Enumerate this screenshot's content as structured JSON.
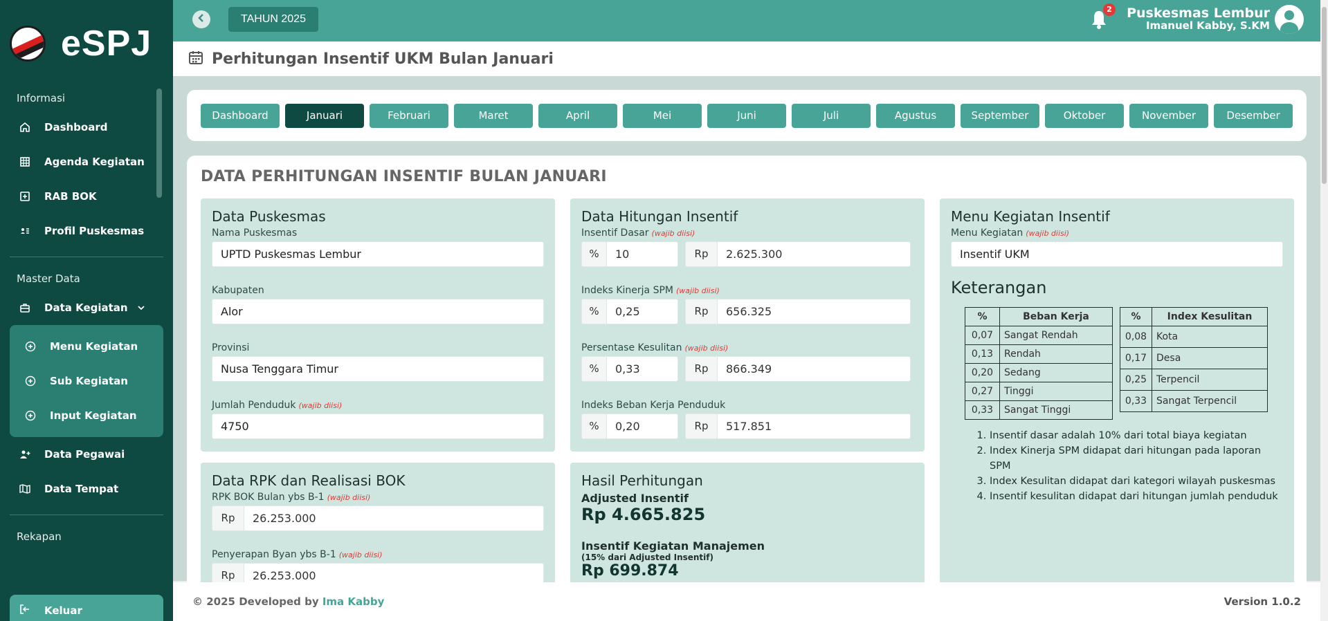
{
  "app": {
    "name": "eSPJ"
  },
  "sidebar": {
    "sections": [
      {
        "label": "Informasi"
      },
      {
        "label": "Master Data"
      },
      {
        "label": "Rekapan"
      }
    ],
    "info_items": [
      {
        "label": "Dashboard",
        "icon": "home-icon"
      },
      {
        "label": "Agenda Kegiatan",
        "icon": "grid-icon"
      },
      {
        "label": "RAB BOK",
        "icon": "plus-square-icon"
      },
      {
        "label": "Profil Puskesmas",
        "icon": "id-card-icon"
      }
    ],
    "master_items": {
      "data_kegiatan": "Data Kegiatan",
      "sub": [
        {
          "label": "Menu Kegiatan"
        },
        {
          "label": "Sub Kegiatan"
        },
        {
          "label": "Input Kegiatan"
        }
      ],
      "data_pegawai": "Data Pegawai",
      "data_tempat": "Data Tempat"
    },
    "logout": "Keluar"
  },
  "topbar": {
    "year": "TAHUN 2025",
    "notif_count": "2",
    "puskesmas": "Puskesmas Lembur",
    "user": "Imanuel Kabby, S.KM"
  },
  "page_title": "Perhitungan Insentif UKM Bulan Januari",
  "months": [
    "Dashboard",
    "Januari",
    "Februari",
    "Maret",
    "April",
    "Mei",
    "Juni",
    "Juli",
    "Agustus",
    "September",
    "Oktober",
    "November",
    "Desember"
  ],
  "active_month": "Januari",
  "main_heading": "DATA PERHITUNGAN INSENTIF BULAN JANUARI",
  "required_tag": "(wajib diisi)",
  "data_puskesmas": {
    "title": "Data Puskesmas",
    "nama_label": "Nama Puskesmas",
    "nama": "UPTD Puskesmas Lembur",
    "kabupaten_label": "Kabupaten",
    "kabupaten": "Alor",
    "provinsi_label": "Provinsi",
    "provinsi": "Nusa Tenggara Timur",
    "penduduk_label": "Jumlah Penduduk",
    "penduduk": "4750"
  },
  "data_hitungan": {
    "title": "Data Hitungan Insentif",
    "rows": [
      {
        "label": "Insentif Dasar",
        "pct": "10",
        "rp": "2.625.300"
      },
      {
        "label": "Indeks Kinerja SPM",
        "pct": "0,25",
        "rp": "656.325"
      },
      {
        "label": "Persentase Kesulitan",
        "pct": "0,33",
        "rp": "866.349"
      },
      {
        "label": "Indeks Beban Kerja Penduduk",
        "pct": "0,20",
        "rp": "517.851"
      }
    ],
    "pct_symbol": "%",
    "rp_symbol": "Rp"
  },
  "menu_kegiatan": {
    "title": "Menu Kegiatan Insentif",
    "label": "Menu Kegiatan",
    "value": "Insentif UKM"
  },
  "keterangan": {
    "title": "Keterangan",
    "beban": {
      "headers": [
        "%",
        "Beban Kerja"
      ],
      "rows": [
        [
          "0,07",
          "Sangat Rendah"
        ],
        [
          "0,13",
          "Rendah"
        ],
        [
          "0,20",
          "Sedang"
        ],
        [
          "0,27",
          "Tinggi"
        ],
        [
          "0,33",
          "Sangat Tinggi"
        ]
      ]
    },
    "kesulitan": {
      "headers": [
        "%",
        "Index Kesulitan"
      ],
      "rows": [
        [
          "0,08",
          "Kota"
        ],
        [
          "0,17",
          "Desa"
        ],
        [
          "0,25",
          "Terpencil"
        ],
        [
          "0,33",
          "Sangat Terpencil"
        ]
      ]
    },
    "notes": [
      "Insentif dasar adalah 10% dari total biaya kegiatan",
      "Index Kinerja SPM didapat dari hitungan pada laporan SPM",
      "Index Kesulitan didapat dari kategori wilayah puskesmas",
      "Insentif kesulitan didapat dari hitungan jumlah penduduk"
    ]
  },
  "rpk": {
    "title": "Data RPK dan Realisasi BOK",
    "rpk_label": "RPK BOK Bulan ybs B-1",
    "rpk_value": "26.253.000",
    "penyerapan_label": "Penyerapan Byan ybs B-1",
    "penyerapan_value": "26.253.000"
  },
  "hasil": {
    "title": "Hasil Perhitungan",
    "adjusted_label": "Adjusted Insentif",
    "adjusted_value": "Rp 4.665.825",
    "manajemen_label": "Insentif Kegiatan Manajemen",
    "manajemen_sub": "(15% dari Adjusted Insentif)",
    "manajemen_value": "Rp 699.874"
  },
  "footer": {
    "copyright": "© 2025 Developed by",
    "author": "Ima Kabby",
    "version": "Version 1.0.2"
  },
  "colors": {
    "sidebar": "#0e4a41",
    "accent": "#48a497",
    "active": "#0e4a41",
    "panel": "#cfe5df",
    "required": "#e53935"
  }
}
